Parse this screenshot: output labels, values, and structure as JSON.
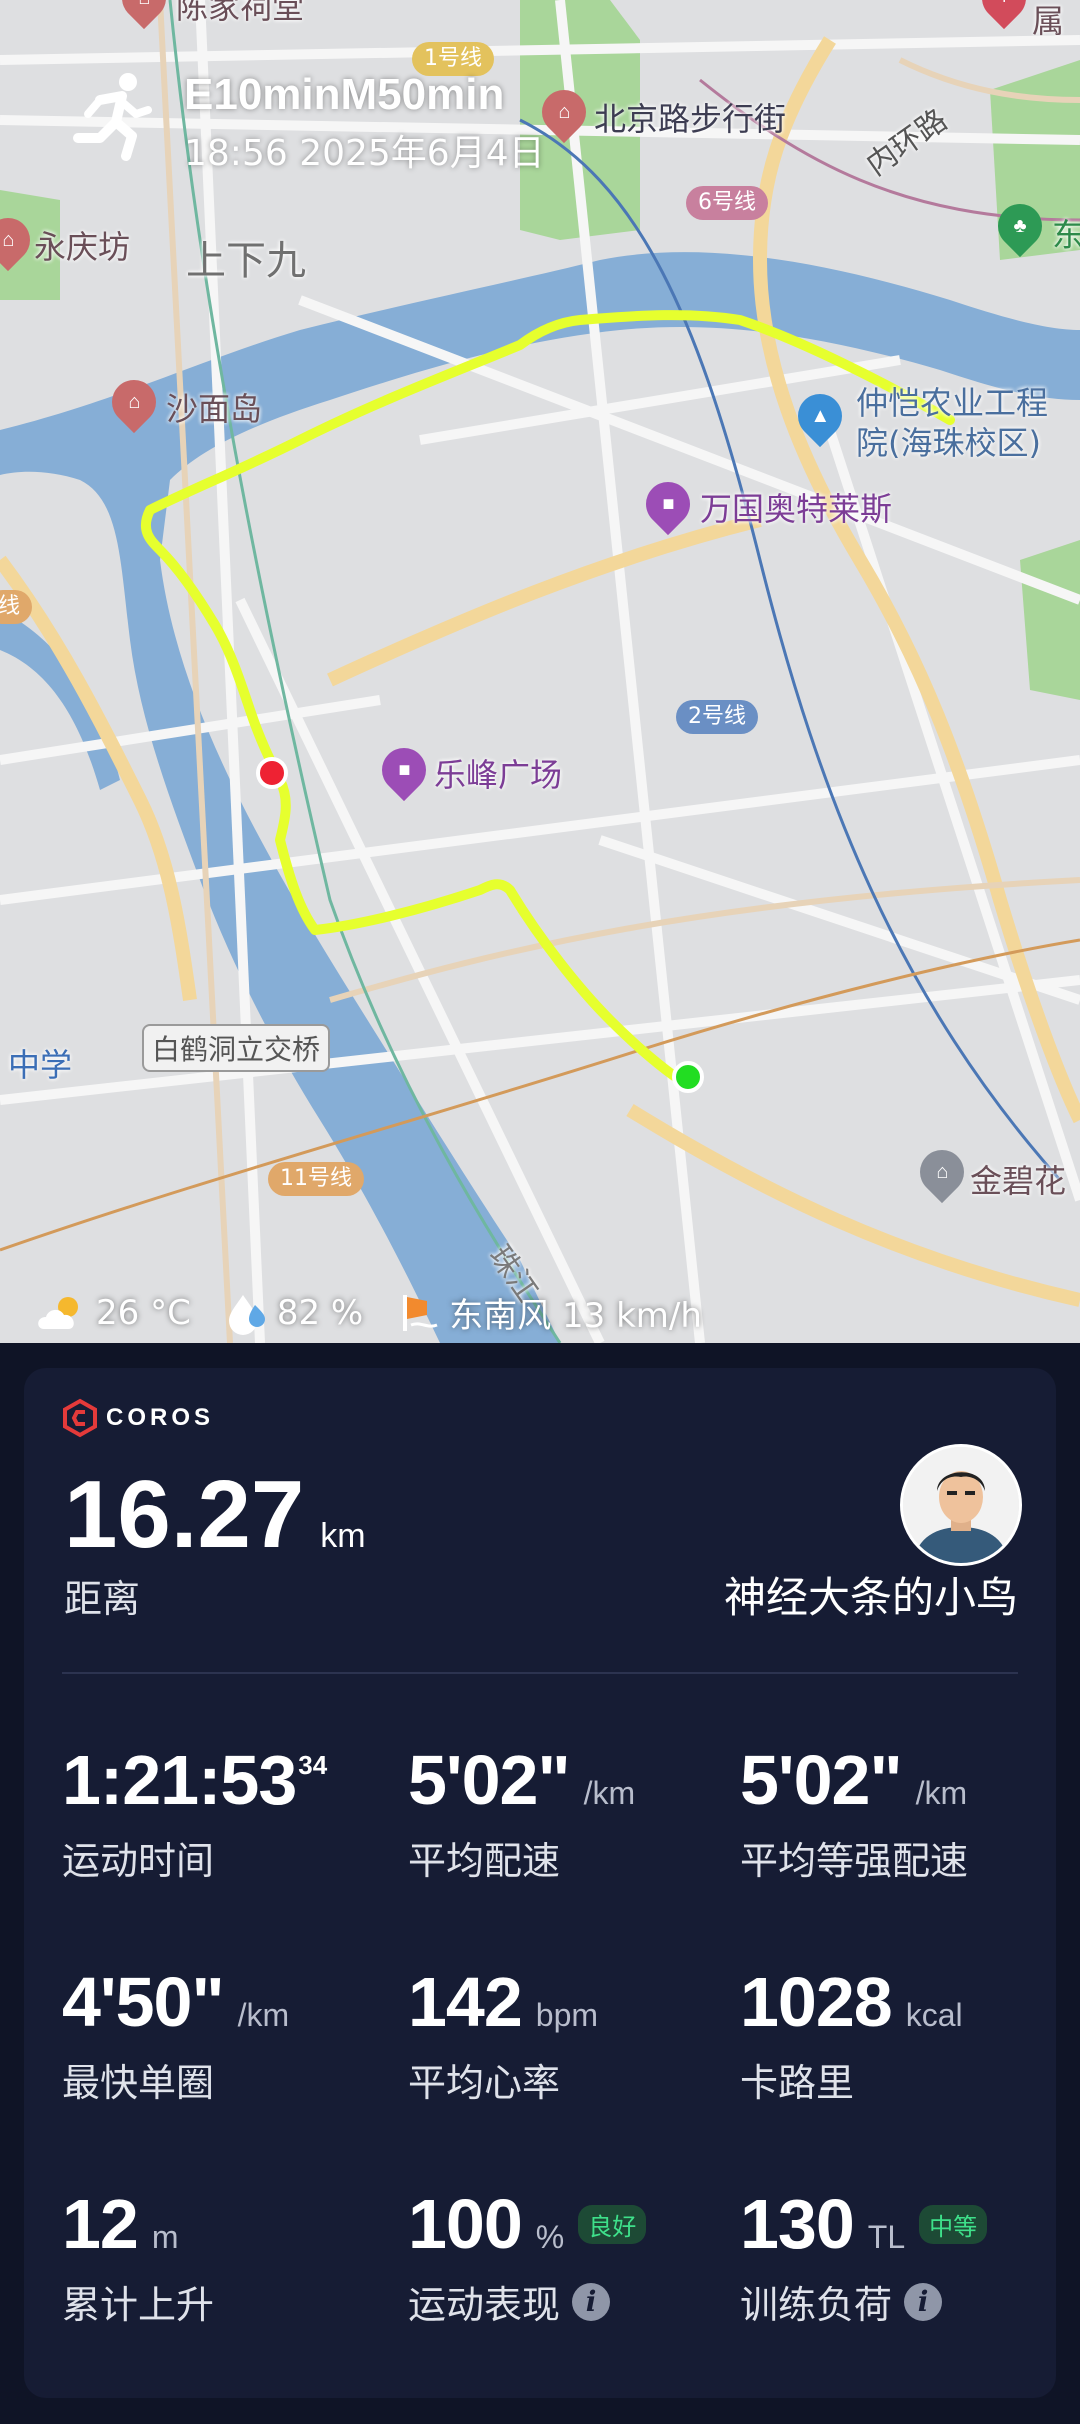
{
  "activity": {
    "title": "E10minM50min",
    "datetime": "18:56 2025年6月4日"
  },
  "map": {
    "labels": {
      "chenjiaci": "陈家祠堂",
      "beijinglu": "北京路步行街",
      "yongqingfang": "永庆坊",
      "shangxiajiu": "上下九",
      "shamiandao": "沙面岛",
      "zhongkai": "仲恺农业工程",
      "zhongkai2": "院(海珠校区)",
      "wanguo": "万国奥特莱斯",
      "lefeng": "乐峰广场",
      "baihedong": "白鹤洞立交桥",
      "zhongxue": "中学",
      "jinbihua": "金碧花",
      "zhujiang": "珠江",
      "neihuanlu": "内环路",
      "dong": "东",
      "shuxiang": "属",
      "line1": "1号线",
      "line6": "6号线",
      "line2": "2号线",
      "line11": "11号线",
      "line_left": "线"
    },
    "route_color": "#e6ff2e",
    "start_color": "#22dd22",
    "end_color": "#ee2233"
  },
  "weather": {
    "temperature": "26 °C",
    "humidity": "82 %",
    "wind": "东南风 13 km/h"
  },
  "card": {
    "brand": "COROS",
    "distance_value": "16.27",
    "distance_unit": "km",
    "distance_label": "距离",
    "user_name": "神经大条的小鸟",
    "stats": [
      {
        "value": "1:21:53",
        "sup": "34",
        "unit": "",
        "label": "运动时间"
      },
      {
        "value": "5'02\"",
        "unit": "/km",
        "label": "平均配速"
      },
      {
        "value": "5'02\"",
        "unit": "/km",
        "label": "平均等强配速"
      },
      {
        "value": "4'50\"",
        "unit": "/km",
        "label": "最快单圈"
      },
      {
        "value": "142",
        "unit": "bpm",
        "label": "平均心率"
      },
      {
        "value": "1028",
        "unit": "kcal",
        "label": "卡路里"
      },
      {
        "value": "12",
        "unit": "m",
        "label": "累计上升"
      },
      {
        "value": "100",
        "unit": "%",
        "badge": "良好",
        "label": "运动表现"
      },
      {
        "value": "130",
        "unit": "TL",
        "badge": "中等",
        "label": "训练负荷"
      }
    ]
  }
}
